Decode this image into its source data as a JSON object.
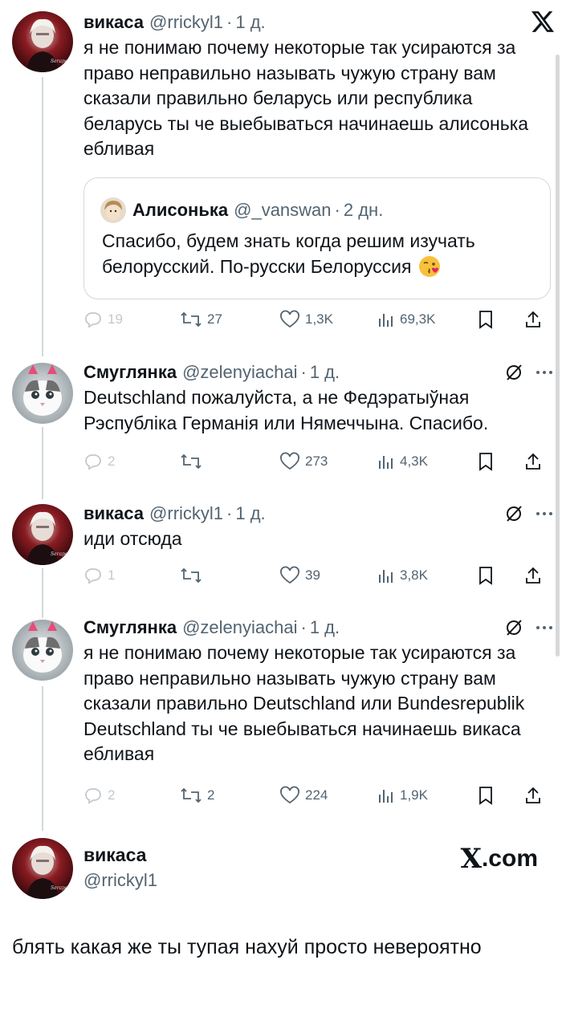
{
  "tweets": [
    {
      "name": "викаса",
      "handle": "@rrickyl1",
      "dot": "·",
      "time": "1 д.",
      "text": "я не понимаю почему некоторые так усираются за право неправильно называть чужую страну вам сказали правильно беларусь или республика беларусь ты че выебываться начинаешь алисонька ебливая",
      "quote": {
        "name": "Алисонька",
        "handle": "@_vanswan",
        "dot": "·",
        "time": "2 дн.",
        "text": "Спасибо, будем знать когда решим изучать белорусский. По-русски Белоруссия",
        "emoji": "kissing-face-heart"
      },
      "actions": {
        "replies": "19",
        "reposts": "27",
        "likes": "1,3K",
        "views": "69,3K"
      }
    },
    {
      "name": "Смуглянка",
      "handle": "@zelenyiachai",
      "dot": "·",
      "time": "1 д.",
      "text": "Deutschland пожалуйста, а не Федэратыўная Рэспубліка Германія или Нямеччына. Спасибо.",
      "actions": {
        "replies": "2",
        "reposts": "",
        "likes": "273",
        "views": "4,3K"
      }
    },
    {
      "name": "викаса",
      "handle": "@rrickyl1",
      "dot": "·",
      "time": "1 д.",
      "text": "иди отсюда",
      "actions": {
        "replies": "1",
        "reposts": "",
        "likes": "39",
        "views": "3,8K"
      }
    },
    {
      "name": "Смуглянка",
      "handle": "@zelenyiachai",
      "dot": "·",
      "time": "1 д.",
      "text": "я не понимаю почему некоторые так усираются за право неправильно называть чужую страну вам сказали правильно Deutschland или Bundesrepublik Deutschland ты че выебываться начинаешь викаса ебливая",
      "actions": {
        "replies": "2",
        "reposts": "2",
        "likes": "224",
        "views": "1,9K"
      }
    }
  ],
  "final": {
    "name": "викаса",
    "handle": "@rrickyl1",
    "brand_x": "X",
    "brand_suffix": ".com",
    "text": "блять какая же ты тупая нахуй просто невероятно"
  },
  "icons": {
    "top_right": "x-logo-icon",
    "more": "more-dots-icon",
    "grok": "grok-slash-icon",
    "reply": "reply-bubble-icon",
    "repost": "repost-arrows-icon",
    "like": "heart-icon",
    "views": "views-bars-icon",
    "bookmark": "bookmark-icon",
    "share": "share-icon"
  },
  "colors": {
    "text": "#0f1419",
    "secondary": "#536471",
    "border": "#cfd9de",
    "background": "#ffffff"
  }
}
